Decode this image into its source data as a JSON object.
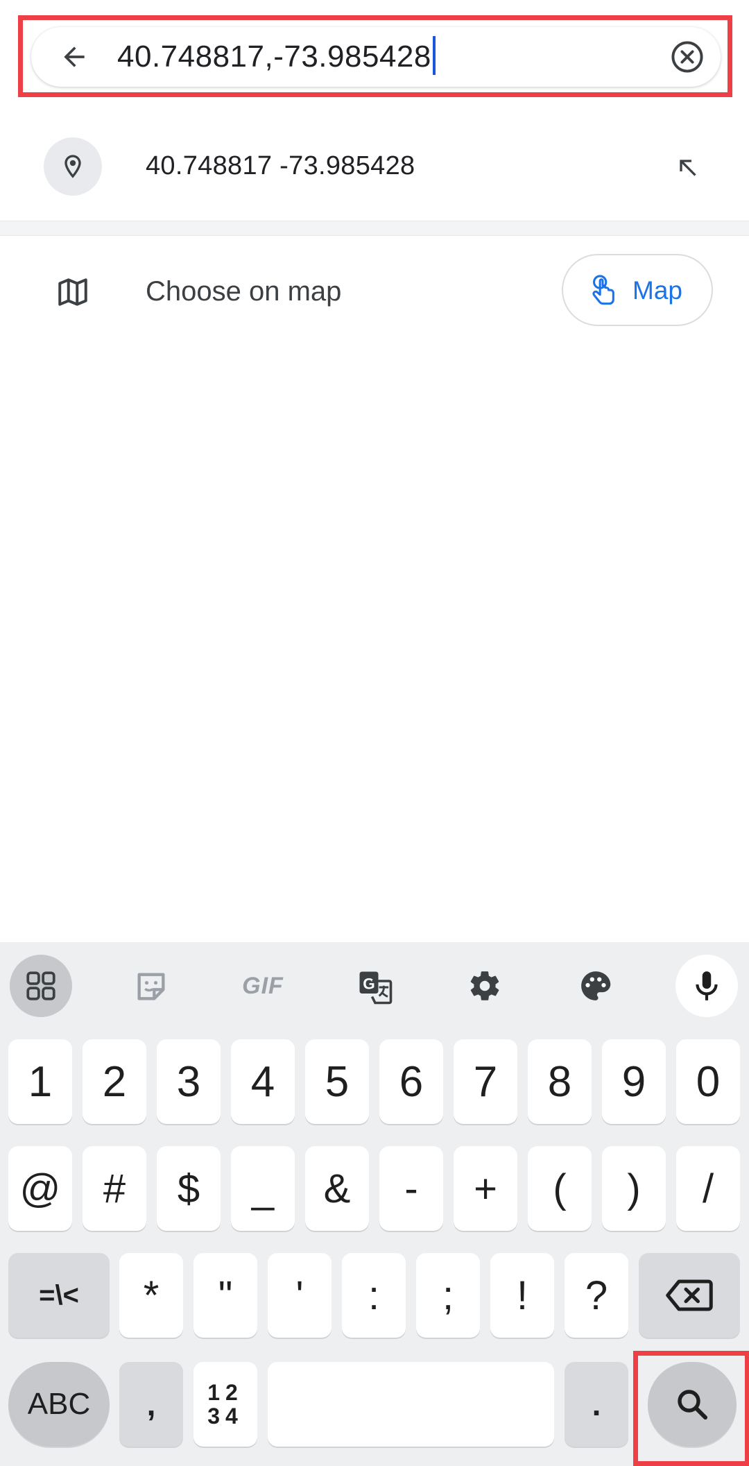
{
  "search": {
    "query": "40.748817,-73.985428",
    "back_icon": "arrow-left-icon",
    "clear_icon": "close-circle-icon"
  },
  "suggestion": {
    "text": "40.748817 -73.985428",
    "icon": "location-pin-icon",
    "fill_icon": "arrow-up-left-icon"
  },
  "choose_on_map": {
    "label": "Choose on map",
    "icon": "map-icon",
    "button_label": "Map",
    "button_icon": "touch-hand-icon"
  },
  "keyboard": {
    "toolbar": [
      "apps-grid-icon",
      "sticker-icon",
      "gif-icon",
      "translate-icon",
      "settings-gear-icon",
      "palette-icon",
      "mic-icon"
    ],
    "gif_label": "GIF",
    "row1": [
      "1",
      "2",
      "3",
      "4",
      "5",
      "6",
      "7",
      "8",
      "9",
      "0"
    ],
    "row2": [
      "@",
      "#",
      "$",
      "_",
      "&",
      "-",
      "+",
      "(",
      ")",
      "/"
    ],
    "row3": [
      "*",
      "\"",
      "'",
      ":",
      ";",
      "!",
      "?"
    ],
    "row3_left": "=\\<",
    "abc_label": "ABC",
    "comma": ",",
    "num_top": "12",
    "num_bottom": "34",
    "period": "."
  },
  "colors": {
    "highlight": "#ee3e46",
    "accent": "#1a73e8",
    "keyboard_bg": "#eeeff1"
  }
}
